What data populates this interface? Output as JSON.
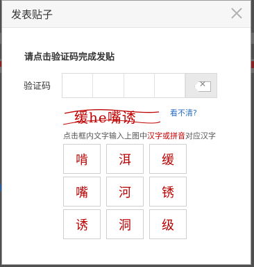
{
  "dialog": {
    "title": "发表贴子",
    "heading": "请点击验证码完成发贴",
    "code_label": "验证码",
    "captcha_text": "缓he嘴诱",
    "refresh_link": "看不清?",
    "instruction": {
      "prefix": "点击框内文字输入上图中",
      "highlight": "汉字或拼音",
      "suffix": "对应汉字"
    },
    "chars": [
      "啃",
      "洱",
      "缓",
      "嘴",
      "河",
      "锈",
      "诱",
      "洞",
      "级"
    ]
  },
  "colors": {
    "captcha_red": "#c00000",
    "link_blue": "#2a6cc0",
    "overlay": "#4f4f4f"
  },
  "icons": {
    "close": "close-icon",
    "backspace": "backspace-icon"
  }
}
